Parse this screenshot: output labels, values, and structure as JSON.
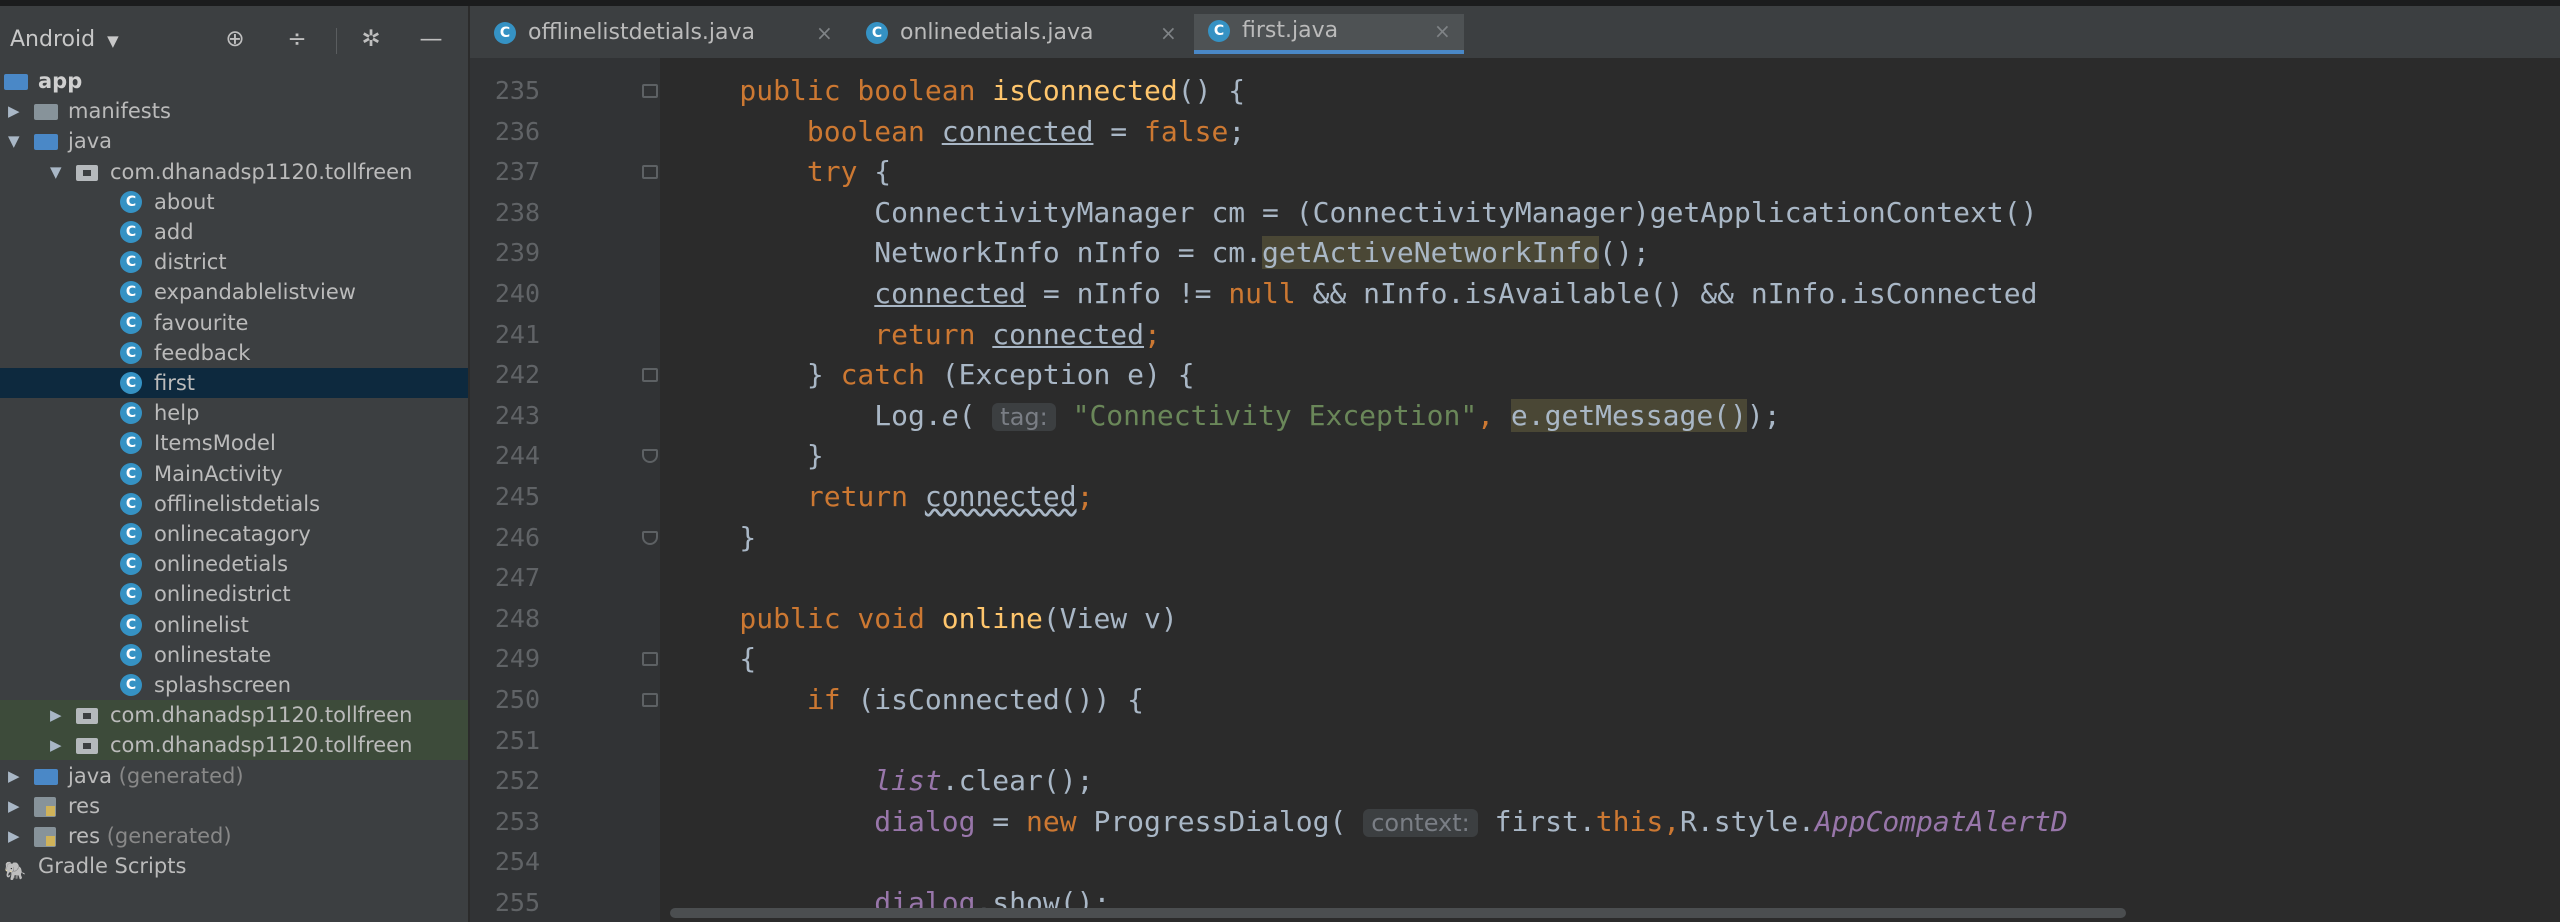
{
  "project_panel": {
    "view_mode": "Android",
    "tools": [
      "target-icon",
      "collapse-icon",
      "gear-icon",
      "minimize-icon"
    ],
    "tree": [
      {
        "label": "app",
        "kind": "module",
        "depth": 0
      },
      {
        "label": "manifests",
        "kind": "folder",
        "depth": 1
      },
      {
        "label": "java",
        "kind": "folder-blue",
        "depth": 1,
        "expanded": true
      },
      {
        "label": "com.dhanadsp1120.tollfreen",
        "kind": "package",
        "depth": 2,
        "expanded": true
      },
      {
        "label": "about",
        "kind": "class",
        "depth": 3
      },
      {
        "label": "add",
        "kind": "class",
        "depth": 3
      },
      {
        "label": "district",
        "kind": "class",
        "depth": 3
      },
      {
        "label": "expandablelistview",
        "kind": "class",
        "depth": 3
      },
      {
        "label": "favourite",
        "kind": "class",
        "depth": 3
      },
      {
        "label": "feedback",
        "kind": "class",
        "depth": 3
      },
      {
        "label": "first",
        "kind": "class",
        "depth": 3,
        "selected": true
      },
      {
        "label": "help",
        "kind": "class",
        "depth": 3
      },
      {
        "label": "ItemsModel",
        "kind": "class",
        "depth": 3
      },
      {
        "label": "MainActivity",
        "kind": "class",
        "depth": 3
      },
      {
        "label": "offlinelistdetials",
        "kind": "class",
        "depth": 3
      },
      {
        "label": "onlinecatagory",
        "kind": "class",
        "depth": 3
      },
      {
        "label": "onlinedetials",
        "kind": "class",
        "depth": 3
      },
      {
        "label": "onlinedistrict",
        "kind": "class",
        "depth": 3
      },
      {
        "label": "onlinelist",
        "kind": "class",
        "depth": 3
      },
      {
        "label": "onlinestate",
        "kind": "class",
        "depth": 3
      },
      {
        "label": "splashscreen",
        "kind": "class",
        "depth": 3
      },
      {
        "label": "com.dhanadsp1120.tollfreen",
        "kind": "package",
        "depth": 2,
        "tinted": true
      },
      {
        "label": "com.dhanadsp1120.tollfreen",
        "kind": "package",
        "depth": 2,
        "tinted": true
      },
      {
        "label": "java",
        "suffix": " (generated)",
        "kind": "folder-gen",
        "depth": 1
      },
      {
        "label": "res",
        "kind": "res",
        "depth": 1
      },
      {
        "label": "res",
        "suffix": " (generated)",
        "kind": "res",
        "depth": 1
      },
      {
        "label": "Gradle Scripts",
        "kind": "gradle",
        "depth": 0
      }
    ]
  },
  "tabs": [
    {
      "label": "offlinelistdetials.java",
      "active": false
    },
    {
      "label": "onlinedetials.java",
      "active": false
    },
    {
      "label": "first.java",
      "active": true
    }
  ],
  "editor": {
    "lines": [
      {
        "n": "235",
        "fold": "start",
        "tokens": [
          [
            "kw",
            "    public boolean "
          ],
          [
            "fn",
            "isConnected"
          ],
          [
            "",
            "() {"
          ]
        ]
      },
      {
        "n": "236",
        "tokens": [
          [
            "kw",
            "        boolean "
          ],
          [
            "ul",
            "connected"
          ],
          [
            "",
            " = "
          ],
          [
            "kw",
            "false"
          ],
          [
            "",
            ";"
          ]
        ]
      },
      {
        "n": "237",
        "fold": "start",
        "tokens": [
          [
            "kw",
            "        try "
          ],
          [
            "",
            "{"
          ]
        ]
      },
      {
        "n": "238",
        "tokens": [
          [
            "",
            "            ConnectivityManager cm = (ConnectivityManager)getApplicationContext()"
          ]
        ]
      },
      {
        "n": "239",
        "tokens": [
          [
            "",
            "            NetworkInfo nInfo = cm."
          ],
          [
            "hl",
            "getActiveNetworkInfo"
          ],
          [
            "",
            "();"
          ]
        ]
      },
      {
        "n": "240",
        "tokens": [
          [
            "",
            "            "
          ],
          [
            "ul",
            "connected"
          ],
          [
            "",
            " = nInfo != "
          ],
          [
            "kw",
            "null"
          ],
          [
            "",
            " && nInfo.isAvailable() && nInfo.isConnected"
          ]
        ]
      },
      {
        "n": "241",
        "tokens": [
          [
            "kw",
            "            return "
          ],
          [
            "ul",
            "connected"
          ],
          [
            "kw",
            ";"
          ]
        ]
      },
      {
        "n": "242",
        "fold": "start",
        "tokens": [
          [
            "",
            "        } "
          ],
          [
            "kw",
            "catch "
          ],
          [
            "",
            "(Exception e) {"
          ]
        ]
      },
      {
        "n": "243",
        "tokens": [
          [
            "",
            "            Log."
          ],
          [
            "it",
            "e"
          ],
          [
            "",
            "( "
          ],
          [
            "hint",
            "tag:"
          ],
          [
            "",
            " "
          ],
          [
            "str",
            "\"Connectivity Exception\""
          ],
          [
            "kw",
            ", "
          ],
          [
            "hl",
            "e.getMessage()"
          ],
          [
            "",
            ");"
          ]
        ]
      },
      {
        "n": "244",
        "fold": "end",
        "tokens": [
          [
            "",
            "        }"
          ]
        ]
      },
      {
        "n": "245",
        "tokens": [
          [
            "kw",
            "        return "
          ],
          [
            "wavy",
            "connected"
          ],
          [
            "kw",
            ";"
          ]
        ]
      },
      {
        "n": "246",
        "fold": "end",
        "tokens": [
          [
            "",
            "    }"
          ]
        ]
      },
      {
        "n": "247",
        "tokens": [
          [
            "",
            ""
          ]
        ]
      },
      {
        "n": "248",
        "tokens": [
          [
            "kw",
            "    public void "
          ],
          [
            "fn",
            "online"
          ],
          [
            "",
            "(View v)"
          ]
        ]
      },
      {
        "n": "249",
        "fold": "start",
        "tokens": [
          [
            "",
            "    {"
          ]
        ]
      },
      {
        "n": "250",
        "fold": "start",
        "tokens": [
          [
            "kw",
            "        if "
          ],
          [
            "",
            "(isConnected()) {"
          ]
        ]
      },
      {
        "n": "251",
        "tokens": [
          [
            "",
            ""
          ]
        ]
      },
      {
        "n": "252",
        "tokens": [
          [
            "",
            "            "
          ],
          [
            "purit",
            "list"
          ],
          [
            "",
            ".clear();"
          ]
        ]
      },
      {
        "n": "253",
        "tokens": [
          [
            "",
            "            "
          ],
          [
            "pur",
            "dialog"
          ],
          [
            "",
            " = "
          ],
          [
            "kw",
            "new "
          ],
          [
            "",
            "ProgressDialog( "
          ],
          [
            "hint",
            "context:"
          ],
          [
            "",
            " first."
          ],
          [
            "kw",
            "this"
          ],
          [
            "kw",
            ","
          ],
          [
            "",
            "R.style."
          ],
          [
            "purit",
            "AppCompatAlertD"
          ]
        ]
      },
      {
        "n": "254",
        "tokens": [
          [
            "",
            ""
          ]
        ]
      },
      {
        "n": "255",
        "tokens": [
          [
            "",
            "            "
          ],
          [
            "pur",
            "dialog"
          ],
          [
            "",
            ".show();"
          ]
        ]
      }
    ]
  }
}
